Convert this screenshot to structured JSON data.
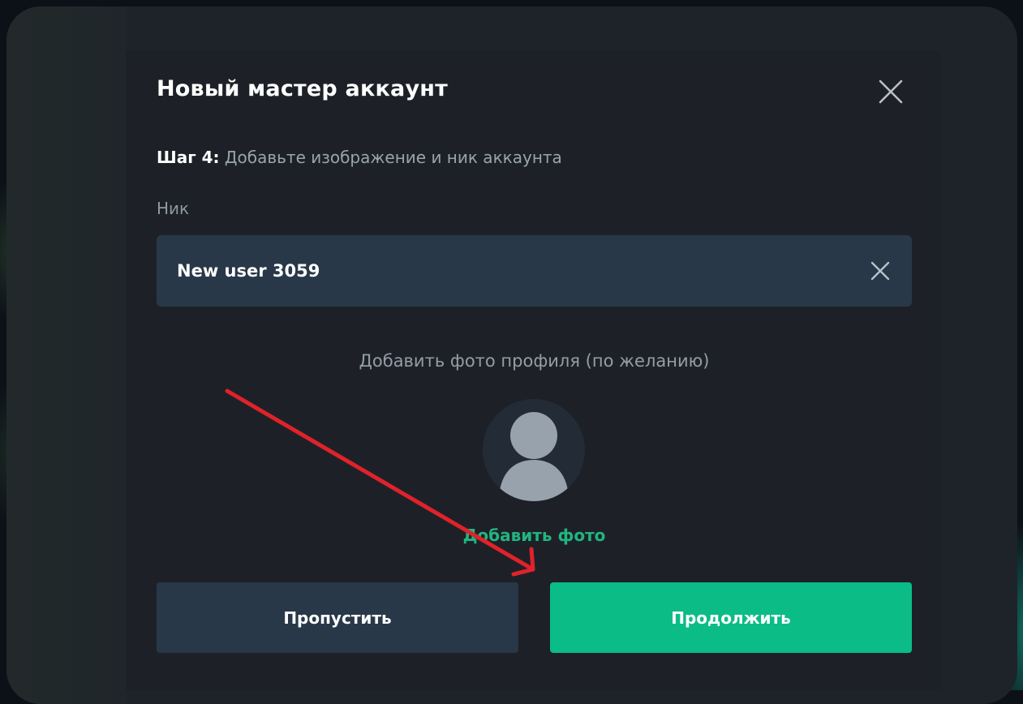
{
  "dialog": {
    "title": "Новый мастер аккаунт",
    "close_icon": "close-icon",
    "step_prefix": "Шаг 4:",
    "step_text": " Добавьте изображение и ник аккаунта"
  },
  "nick": {
    "label": "Ник",
    "value": "New user 3059",
    "clear_icon": "clear-icon"
  },
  "photo": {
    "label": "Добавить фото профиля (по желанию)",
    "avatar_icon": "user-avatar-icon",
    "add_label": "Добавить фото"
  },
  "actions": {
    "skip_label": "Пропустить",
    "continue_label": "Продолжить"
  },
  "colors": {
    "accent": "#0bbc86",
    "link": "#22b47f",
    "annotation_arrow": "#e0222a",
    "field_background": "#283848"
  }
}
